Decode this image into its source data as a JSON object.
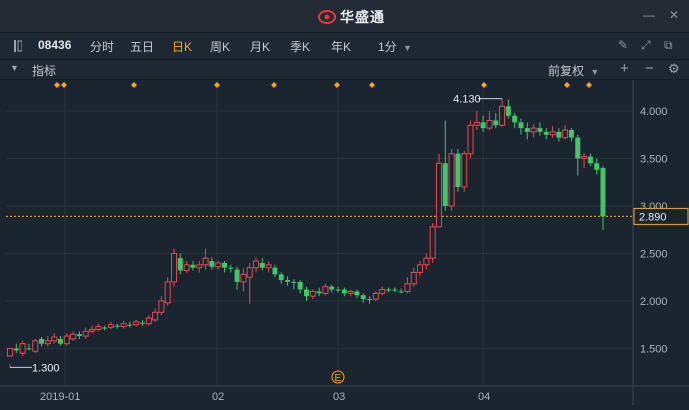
{
  "app": {
    "brand": "华盛通"
  },
  "toolbar": {
    "stock_code": "08436",
    "periods": [
      "分时",
      "五日",
      "日K",
      "周K",
      "月K",
      "季K",
      "年K"
    ],
    "active_period": "日K",
    "interval": "1分"
  },
  "indicator_bar": {
    "label": "指标",
    "adjust": "前复权"
  },
  "colors": {
    "up": "#e8484f",
    "down": "#3fc76b",
    "marker": "#f6a81c",
    "bg": "#1b2530",
    "ref_line": "#f6a81c"
  },
  "chart_data": {
    "type": "candlestick",
    "x_labels": [
      "2019-01",
      "02",
      "03",
      "04"
    ],
    "y_ticks": [
      "4.000",
      "3.500",
      "3.000",
      "2.500",
      "2.000",
      "1.500"
    ],
    "ylim": [
      1.22,
      4.2
    ],
    "current_price": "2.890",
    "high_label": "4.130",
    "low_label": "1.300",
    "event_marker": "E",
    "candles": [
      [
        1.42,
        1.5,
        1.33,
        1.3,
        "up"
      ],
      [
        1.5,
        1.48,
        1.55,
        1.45,
        "down"
      ],
      [
        1.45,
        1.55,
        1.58,
        1.42,
        "up"
      ],
      [
        1.5,
        1.5,
        1.55,
        1.48,
        "down"
      ],
      [
        1.47,
        1.58,
        1.6,
        1.45,
        "up"
      ],
      [
        1.6,
        1.55,
        1.62,
        1.52,
        "down"
      ],
      [
        1.55,
        1.58,
        1.63,
        1.52,
        "up"
      ],
      [
        1.58,
        1.62,
        1.66,
        1.55,
        "up"
      ],
      [
        1.6,
        1.55,
        1.63,
        1.53,
        "down"
      ],
      [
        1.55,
        1.63,
        1.66,
        1.53,
        "up"
      ],
      [
        1.6,
        1.65,
        1.68,
        1.58,
        "up"
      ],
      [
        1.65,
        1.63,
        1.68,
        1.6,
        "down"
      ],
      [
        1.63,
        1.68,
        1.72,
        1.6,
        "up"
      ],
      [
        1.68,
        1.7,
        1.74,
        1.66,
        "up"
      ],
      [
        1.7,
        1.73,
        1.76,
        1.68,
        "up"
      ],
      [
        1.72,
        1.72,
        1.74,
        1.69,
        "down"
      ],
      [
        1.72,
        1.75,
        1.78,
        1.7,
        "up"
      ],
      [
        1.74,
        1.73,
        1.76,
        1.71,
        "down"
      ],
      [
        1.73,
        1.76,
        1.79,
        1.71,
        "up"
      ],
      [
        1.75,
        1.75,
        1.78,
        1.72,
        "down"
      ],
      [
        1.75,
        1.78,
        1.8,
        1.73,
        "up"
      ],
      [
        1.77,
        1.76,
        1.8,
        1.74,
        "down"
      ],
      [
        1.76,
        1.82,
        1.85,
        1.74,
        "up"
      ],
      [
        1.8,
        1.88,
        1.92,
        1.78,
        "up"
      ],
      [
        1.88,
        2.0,
        2.05,
        1.85,
        "up"
      ],
      [
        1.98,
        2.2,
        2.25,
        1.95,
        "up"
      ],
      [
        2.2,
        2.5,
        2.55,
        2.15,
        "up"
      ],
      [
        2.45,
        2.32,
        2.5,
        2.28,
        "down"
      ],
      [
        2.32,
        2.38,
        2.42,
        2.3,
        "up"
      ],
      [
        2.38,
        2.35,
        2.42,
        2.32,
        "down"
      ],
      [
        2.35,
        2.38,
        2.42,
        2.3,
        "up"
      ],
      [
        2.38,
        2.45,
        2.55,
        2.33,
        "up"
      ],
      [
        2.42,
        2.36,
        2.46,
        2.33,
        "down"
      ],
      [
        2.36,
        2.4,
        2.42,
        2.33,
        "up"
      ],
      [
        2.4,
        2.35,
        2.42,
        2.3,
        "down"
      ],
      [
        2.35,
        2.35,
        2.38,
        2.3,
        "down"
      ],
      [
        2.33,
        2.2,
        2.36,
        2.12,
        "down"
      ],
      [
        2.2,
        2.28,
        2.34,
        2.1,
        "up"
      ],
      [
        2.25,
        2.35,
        2.4,
        1.97,
        "up"
      ],
      [
        2.35,
        2.42,
        2.46,
        2.3,
        "up"
      ],
      [
        2.4,
        2.35,
        2.45,
        2.32,
        "down"
      ],
      [
        2.35,
        2.38,
        2.42,
        2.3,
        "up"
      ],
      [
        2.35,
        2.28,
        2.38,
        2.25,
        "down"
      ],
      [
        2.28,
        2.22,
        2.3,
        2.18,
        "down"
      ],
      [
        2.22,
        2.2,
        2.26,
        2.16,
        "down"
      ],
      [
        2.2,
        2.2,
        2.23,
        2.12,
        "down"
      ],
      [
        2.2,
        2.12,
        2.22,
        2.08,
        "down"
      ],
      [
        2.12,
        2.05,
        2.15,
        2.0,
        "down"
      ],
      [
        2.05,
        2.1,
        2.12,
        2.02,
        "up"
      ],
      [
        2.1,
        2.08,
        2.14,
        2.05,
        "down"
      ],
      [
        2.08,
        2.15,
        2.18,
        2.06,
        "up"
      ],
      [
        2.15,
        2.12,
        2.17,
        2.09,
        "down"
      ],
      [
        2.12,
        2.12,
        2.15,
        2.09,
        "down"
      ],
      [
        2.12,
        2.08,
        2.14,
        2.05,
        "down"
      ],
      [
        2.08,
        2.1,
        2.12,
        2.05,
        "up"
      ],
      [
        2.1,
        2.06,
        2.12,
        2.03,
        "down"
      ],
      [
        2.06,
        2.02,
        2.08,
        1.98,
        "down"
      ],
      [
        2.02,
        2.02,
        2.05,
        1.97,
        "down"
      ],
      [
        2.02,
        2.08,
        2.1,
        2.0,
        "up"
      ],
      [
        2.08,
        2.12,
        2.15,
        2.06,
        "up"
      ],
      [
        2.12,
        2.12,
        2.14,
        2.09,
        "down"
      ],
      [
        2.12,
        2.12,
        2.14,
        2.09,
        "down"
      ],
      [
        2.1,
        2.1,
        2.13,
        2.08,
        "down"
      ],
      [
        2.1,
        2.18,
        2.25,
        2.08,
        "up"
      ],
      [
        2.18,
        2.3,
        2.35,
        2.15,
        "up"
      ],
      [
        2.3,
        2.38,
        2.42,
        2.26,
        "up"
      ],
      [
        2.38,
        2.45,
        2.5,
        2.33,
        "up"
      ],
      [
        2.45,
        2.78,
        2.82,
        2.4,
        "up"
      ],
      [
        2.78,
        3.45,
        3.55,
        2.9,
        "up"
      ],
      [
        3.45,
        3.0,
        3.9,
        2.95,
        "down"
      ],
      [
        3.0,
        3.55,
        3.6,
        2.95,
        "up"
      ],
      [
        3.55,
        3.2,
        3.6,
        3.15,
        "down"
      ],
      [
        3.2,
        3.55,
        3.58,
        3.15,
        "up"
      ],
      [
        3.55,
        3.85,
        3.9,
        3.5,
        "up"
      ],
      [
        3.85,
        3.88,
        4.0,
        3.8,
        "up"
      ],
      [
        3.88,
        3.82,
        3.95,
        3.78,
        "down"
      ],
      [
        3.82,
        3.9,
        4.0,
        3.8,
        "up"
      ],
      [
        3.9,
        3.85,
        3.98,
        3.82,
        "down"
      ],
      [
        3.85,
        4.05,
        4.13,
        3.83,
        "up"
      ],
      [
        4.05,
        3.95,
        4.12,
        3.92,
        "down"
      ],
      [
        3.95,
        3.88,
        3.98,
        3.82,
        "down"
      ],
      [
        3.88,
        3.82,
        3.92,
        3.75,
        "down"
      ],
      [
        3.82,
        3.78,
        3.88,
        3.7,
        "down"
      ],
      [
        3.78,
        3.82,
        3.86,
        3.72,
        "up"
      ],
      [
        3.82,
        3.78,
        3.88,
        3.74,
        "down"
      ],
      [
        3.78,
        3.75,
        3.82,
        3.7,
        "down"
      ],
      [
        3.75,
        3.78,
        3.84,
        3.72,
        "up"
      ],
      [
        3.78,
        3.72,
        3.82,
        3.68,
        "down"
      ],
      [
        3.72,
        3.8,
        3.85,
        3.7,
        "up"
      ],
      [
        3.8,
        3.72,
        3.82,
        3.68,
        "down"
      ],
      [
        3.72,
        3.5,
        3.75,
        3.32,
        "down"
      ],
      [
        3.5,
        3.52,
        3.56,
        3.4,
        "up"
      ],
      [
        3.52,
        3.45,
        3.55,
        3.42,
        "down"
      ],
      [
        3.45,
        3.38,
        3.5,
        3.33,
        "down"
      ],
      [
        3.4,
        2.89,
        3.42,
        2.75,
        "down"
      ]
    ]
  }
}
